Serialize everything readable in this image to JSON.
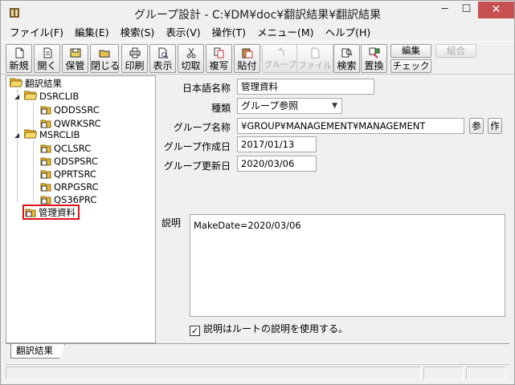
{
  "window": {
    "title": "グループ設計 - C:¥DM¥doc¥翻訳結果¥翻訳結果",
    "minimize": "─",
    "maximize": "☐",
    "close": "✕"
  },
  "menu": [
    "ファイル(F)",
    "編集(E)",
    "検索(S)",
    "表示(V)",
    "操作(T)",
    "メニュー(M)",
    "ヘルプ(H)"
  ],
  "toolbar": {
    "new": "新規",
    "open": "開く",
    "save": "保管",
    "close": "閉じる",
    "print": "印刷",
    "view": "表示",
    "cut": "切取",
    "copy": "複写",
    "paste": "貼付",
    "group": "グループ",
    "file": "ファイル",
    "search": "検索",
    "replace": "置換",
    "edit": "編集",
    "combine": "組合",
    "check": "チェック"
  },
  "tree": {
    "root": "翻訳結果",
    "lib1": "DSRCLIB",
    "lib1_items": [
      "QDDSSRC",
      "QWRKSRC"
    ],
    "lib2": "MSRCLIB",
    "lib2_items": [
      "QCLSRC",
      "QDSPSRC",
      "QPRTSRC",
      "QRPGSRC",
      "QS36PRC"
    ],
    "selected": "管理資料"
  },
  "form": {
    "jp_name_label": "日本語名称",
    "jp_name_value": "管理資料",
    "type_label": "種類",
    "type_value": "グループ参照",
    "group_name_label": "グループ名称",
    "group_name_value": "¥GROUP¥MANAGEMENT¥MANAGEMENT",
    "ref_btn": "参",
    "make_btn": "作",
    "created_label": "グループ作成日",
    "created_value": "2017/01/13",
    "updated_label": "グループ更新日",
    "updated_value": "2020/03/06",
    "desc_label": "説明",
    "desc_value": "MakeDate=2020/03/06",
    "use_root_desc_label": "説明はルートの説明を使用する。",
    "use_root_desc_checked": true
  },
  "bottom_tab": "翻訳結果",
  "colors": {
    "selection_border": "#e0101a",
    "close_button": "#c75050",
    "folder": "#e8b830"
  }
}
